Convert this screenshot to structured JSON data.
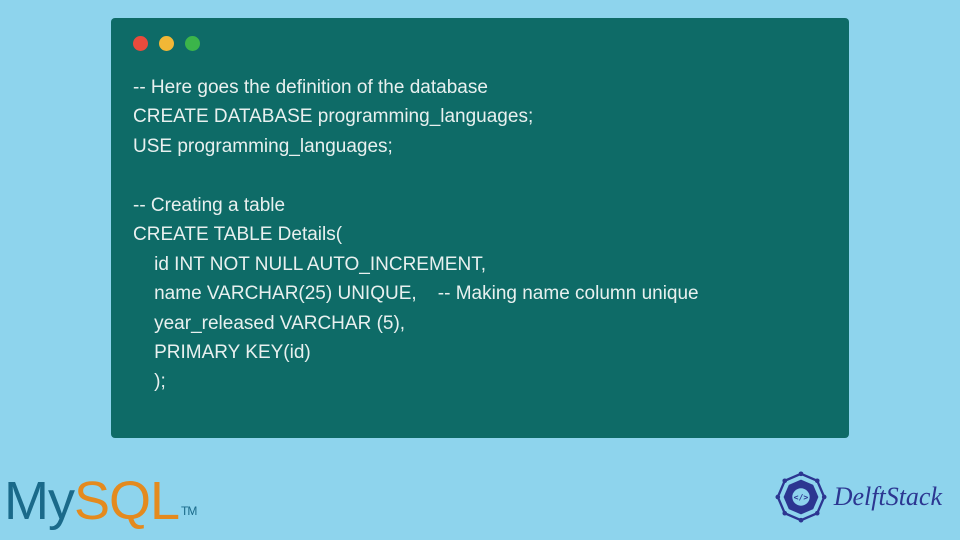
{
  "code": {
    "line1": "-- Here goes the definition of the database",
    "line2": "CREATE DATABASE programming_languages;",
    "line3": "USE programming_languages;",
    "line4": "",
    "line5": "-- Creating a table",
    "line6": "CREATE TABLE Details(",
    "line7": "    id INT NOT NULL AUTO_INCREMENT,",
    "line8": "    name VARCHAR(25) UNIQUE,    -- Making name column unique",
    "line9": "    year_released VARCHAR (5),",
    "line10": "    PRIMARY KEY(id)",
    "line11": "    );"
  },
  "logos": {
    "mysql_my": "My",
    "mysql_sql": "SQL",
    "mysql_tm": "TM",
    "delftstack": "DelftStack"
  }
}
